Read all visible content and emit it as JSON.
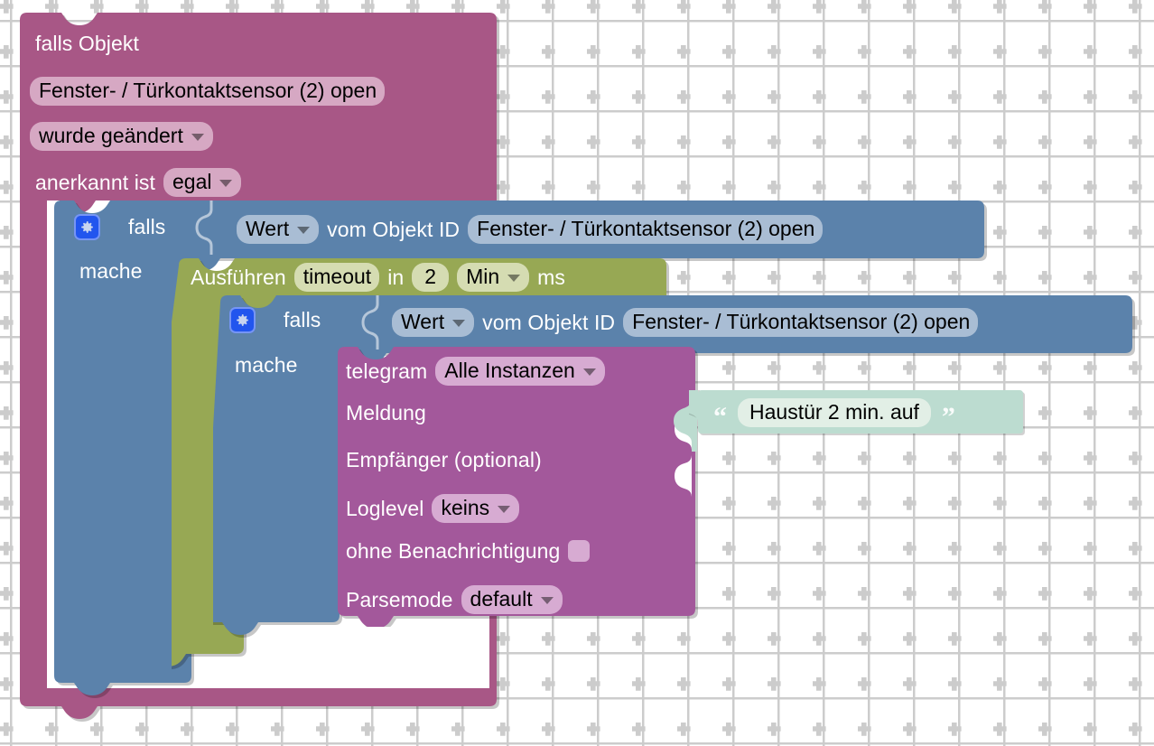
{
  "workspace": {
    "name": "blockly-workspace",
    "background": "#ffffff",
    "grid_dot_color": "#cccccc",
    "grid_spacing": 50
  },
  "colors": {
    "trigger_magenta": "#a85786",
    "trigger_magenta_field": "#d6a8c3",
    "control_blue": "#5b82ab",
    "control_blue_field": "#a9bdd4",
    "timeout_olive": "#97a854",
    "timeout_olive_field": "#d5dcb2",
    "telegram_purple": "#a3589b",
    "telegram_purple_field": "#d7abd2",
    "text_mint": "#bcdcd0",
    "text_mint_field": "#e2efe6",
    "gear_button_blue": "#2255ee"
  },
  "blocks": {
    "trigger": {
      "name": "falls-objekt-trigger",
      "line1": "falls Objekt",
      "object_id": "Fenster- / Türkontaktsensor (2) open",
      "change_mode": "wurde geändert",
      "ack_label": "anerkannt ist",
      "ack_value": "egal"
    },
    "if_outer": {
      "name": "falls-controls-if-outer",
      "gear_icon": "gear-icon",
      "if_label": "falls",
      "value_mode": "Wert",
      "from_object_label": "vom Objekt ID",
      "object_id": "Fenster- / Türkontaktsensor (2) open",
      "do_label": "mache"
    },
    "timeout": {
      "name": "ausfuehren-timeout",
      "run_label": "Ausführen",
      "name_value": "timeout",
      "in_label": "in",
      "delay_value": "2",
      "unit_value": "Min",
      "ms_label": "ms"
    },
    "if_inner": {
      "name": "falls-controls-if-inner",
      "gear_icon": "gear-icon",
      "if_label": "falls",
      "value_mode": "Wert",
      "from_object_label": "vom Objekt ID",
      "object_id": "Fenster- / Türkontaktsensor (2) open",
      "do_label": "mache"
    },
    "telegram": {
      "name": "telegram-sendto",
      "title": "telegram",
      "instance": "Alle Instanzen",
      "message_label": "Meldung",
      "recipient_label": "Empfänger (optional)",
      "loglevel_label": "Loglevel",
      "loglevel_value": "keins",
      "silent_label": "ohne Benachrichtigung",
      "silent_checked": false,
      "parsemode_label": "Parsemode",
      "parsemode_value": "default"
    },
    "text": {
      "name": "text-string-literal",
      "open_quote": "“",
      "value": "Haustür 2 min. auf",
      "close_quote": "”"
    }
  }
}
